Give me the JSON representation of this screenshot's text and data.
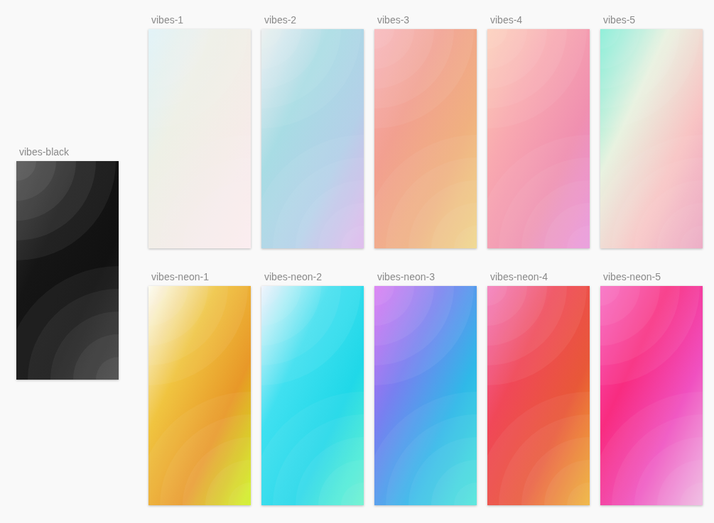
{
  "artboards_left": [
    {
      "label": "vibes-black",
      "kind": "picture"
    }
  ],
  "artboards": [
    {
      "label": "vibes-1",
      "kind": "picture"
    },
    {
      "label": "vibes-2",
      "kind": "picture"
    },
    {
      "label": "vibes-3",
      "kind": "picture"
    },
    {
      "label": "vibes-4",
      "kind": "picture"
    },
    {
      "label": "vibes-5",
      "kind": "picture"
    },
    {
      "label": "vibes-neon-1",
      "kind": "picture"
    },
    {
      "label": "vibes-neon-2",
      "kind": "picture"
    },
    {
      "label": "vibes-neon-3",
      "kind": "picture"
    },
    {
      "label": "vibes-neon-4",
      "kind": "picture"
    },
    {
      "label": "vibes-neon-5",
      "kind": "picture"
    }
  ]
}
